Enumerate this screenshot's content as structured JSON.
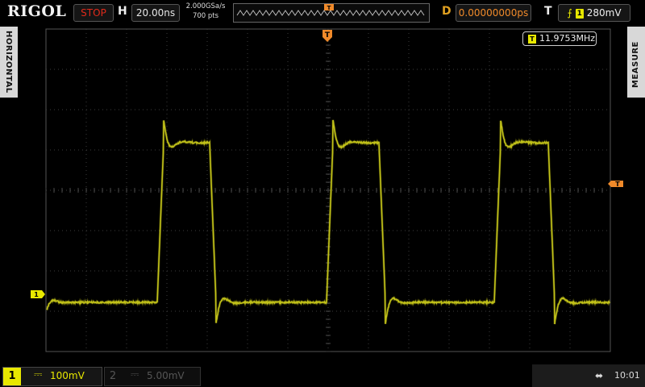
{
  "header": {
    "brand": "RIGOL",
    "run_state": "STOP",
    "horizontal_label": "H",
    "timebase": "20.00ns",
    "sample_rate": "2.000GSa/s",
    "memory_depth": "700  pts",
    "delay_label": "D",
    "delay_value": "0.00000000ps",
    "trigger_label": "T",
    "trigger_source": "1",
    "trigger_level": "280mV"
  },
  "side_tabs": {
    "left": "HORIZONTAL",
    "right": "MEASURE"
  },
  "measurement": {
    "badge": "T",
    "value": "11.9753MHz"
  },
  "channels": [
    {
      "number": "1",
      "coupling_icon": "dc-coupling-icon",
      "scale": "100mV",
      "active": true,
      "color": "#e8e800"
    },
    {
      "number": "2",
      "coupling_icon": "dc-coupling-icon",
      "scale": "5.00mV",
      "active": false,
      "color": "#555555"
    }
  ],
  "status": {
    "clock": "10:01",
    "usb_icon": "usb-icon"
  },
  "colors": {
    "trace": "#d8d820",
    "grid": "#3a3a3a",
    "trigger_marker": "#f08a2a",
    "ch1_marker": "#e8e800"
  }
}
